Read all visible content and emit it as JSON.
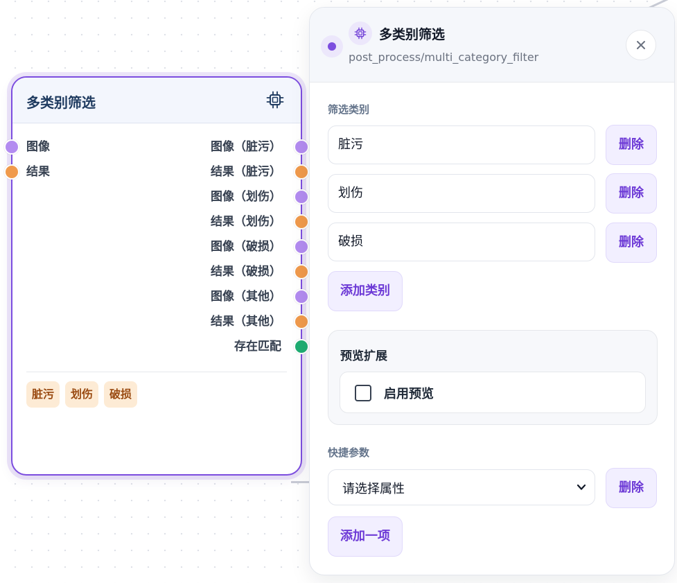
{
  "node": {
    "title": "多类别筛选",
    "icon": "chip-icon",
    "inputs": [
      {
        "label": "图像",
        "color": "#b38cf0"
      },
      {
        "label": "结果",
        "color": "#f09a4c"
      }
    ],
    "outputs": [
      {
        "label": "图像（脏污）",
        "color": "#b38cf0"
      },
      {
        "label": "结果（脏污）",
        "color": "#f09a4c"
      },
      {
        "label": "图像（划伤）",
        "color": "#b38cf0"
      },
      {
        "label": "结果（划伤）",
        "color": "#f09a4c"
      },
      {
        "label": "图像（破损）",
        "color": "#b38cf0"
      },
      {
        "label": "结果（破损）",
        "color": "#f09a4c"
      },
      {
        "label": "图像（其他）",
        "color": "#b38cf0"
      },
      {
        "label": "结果（其他）",
        "color": "#f09a4c"
      },
      {
        "label": "存在匹配",
        "color": "#1fad72"
      }
    ],
    "tags": [
      "脏污",
      "划伤",
      "破损"
    ]
  },
  "panel": {
    "title": "多类别筛选",
    "path": "post_process/multi_category_filter",
    "close_icon": "close-icon",
    "categories_label": "筛选类别",
    "categories": [
      "脏污",
      "划伤",
      "破损"
    ],
    "delete_label": "删除",
    "add_category_label": "添加类别",
    "preview": {
      "title": "预览扩展",
      "checkbox_label": "启用预览",
      "checked": false
    },
    "quick_params": {
      "label": "快捷参数",
      "select_value": "请选择属性",
      "delete_label": "删除",
      "add_item_label": "添加一项"
    }
  },
  "colors": {
    "accent": "#7c4ddf",
    "port_image": "#b38cf0",
    "port_result": "#f09a4c",
    "port_match": "#1fad72"
  }
}
